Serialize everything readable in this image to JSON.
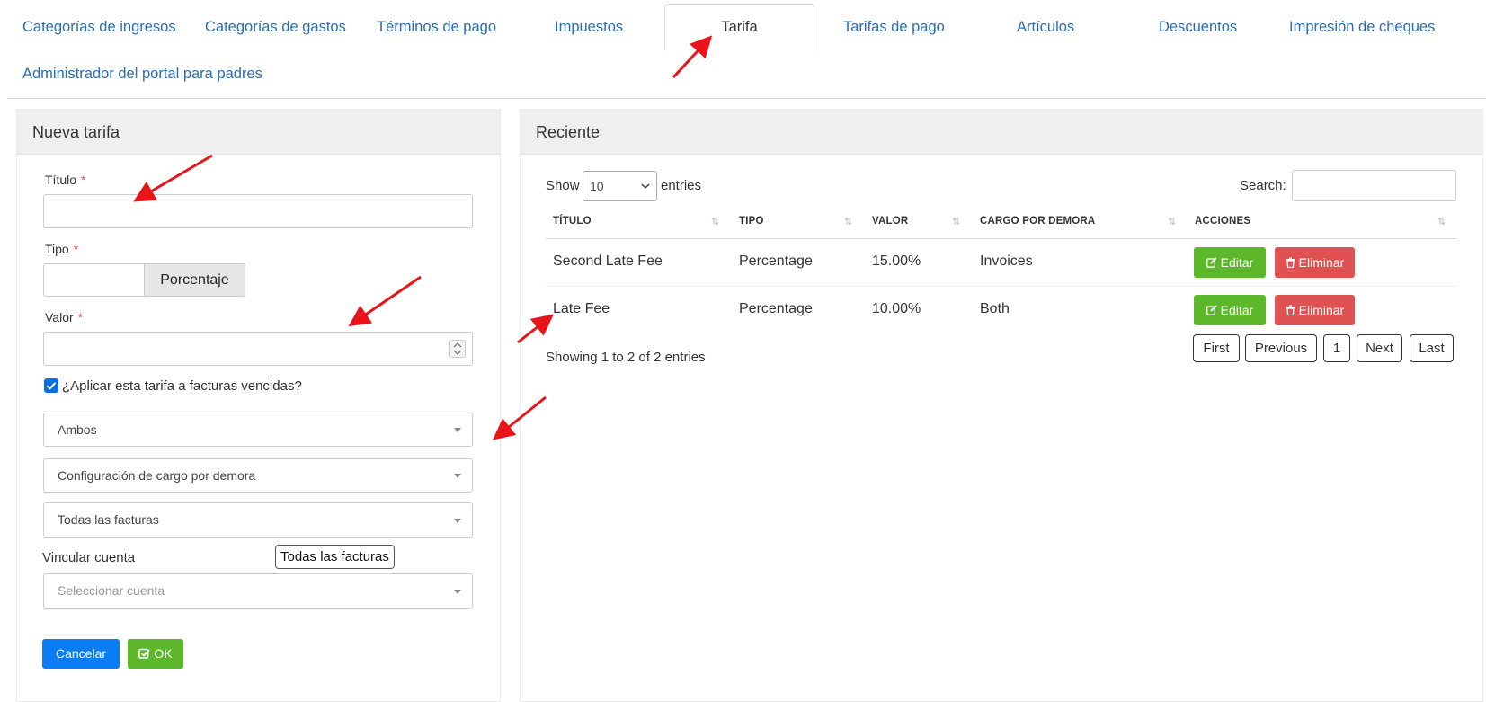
{
  "tabs": [
    {
      "label": "Categorías de ingresos"
    },
    {
      "label": "Categorías de gastos"
    },
    {
      "label": "Términos de pago"
    },
    {
      "label": "Impuestos"
    },
    {
      "label": "Tarifa"
    },
    {
      "label": "Tarifas de pago"
    },
    {
      "label": "Artículos"
    },
    {
      "label": "Descuentos"
    },
    {
      "label": "Impresión de cheques"
    },
    {
      "label": "Administrador del portal para padres"
    }
  ],
  "active_tab": "Tarifa",
  "form": {
    "title": "Nueva tarifa",
    "titulo_label": "Título",
    "tipo_label": "Tipo",
    "tipo_value": "",
    "tipo_button": "Porcentaje",
    "valor_label": "Valor",
    "required_mark": "*",
    "checkbox_label": "¿Aplicar esta tarifa a facturas vencidas?",
    "checkbox_checked": true,
    "select_apply": "Ambos",
    "select_late_fee_config": "Configuración de cargo por demora",
    "select_invoices": "Todas las facturas",
    "tooltip": "Todas las facturas",
    "vincular_label": "Vincular cuenta",
    "vincular_placeholder": "Seleccionar cuenta",
    "cancel_label": "Cancelar",
    "ok_label": "OK"
  },
  "recent": {
    "title": "Reciente",
    "show_label": "Show",
    "entries_value": "10",
    "entries_label": "entries",
    "search_label": "Search:",
    "columns": [
      "TÍTULO",
      "TIPO",
      "VALOR",
      "CARGO POR DEMORA",
      "ACCIONES"
    ],
    "rows": [
      {
        "titulo": "Second Late Fee",
        "tipo": "Percentage",
        "valor": "15.00%",
        "cargo": "Invoices"
      },
      {
        "titulo": "Late Fee",
        "tipo": "Percentage",
        "valor": "10.00%",
        "cargo": "Both"
      }
    ],
    "edit_label": "Editar",
    "delete_label": "Eliminar",
    "info": "Showing 1 to 2 of 2 entries",
    "pagination": {
      "first": "First",
      "previous": "Previous",
      "page": "1",
      "next": "Next",
      "last": "Last"
    }
  },
  "colors": {
    "link": "#2a6db0",
    "primary": "#0a7cf4",
    "success": "#5cb82a",
    "danger": "#e05252",
    "annotation": "#e8141a"
  },
  "icons": [
    "edit-icon",
    "trash-icon",
    "check-icon",
    "sort-icon",
    "chevron-down-icon"
  ]
}
